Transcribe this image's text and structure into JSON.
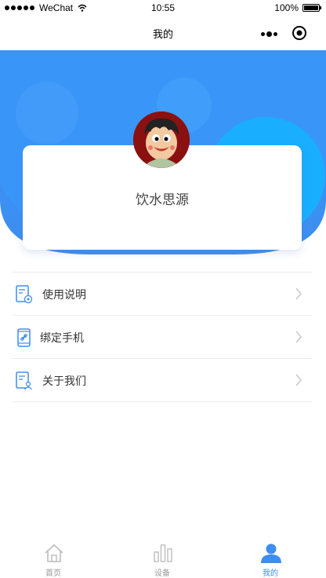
{
  "status_bar": {
    "carrier": "WeChat",
    "time": "10:55",
    "battery": "100%"
  },
  "nav": {
    "title": "我的"
  },
  "profile": {
    "username": "饮水思源"
  },
  "menu": [
    {
      "label": "使用说明",
      "icon": "manual-icon"
    },
    {
      "label": "绑定手机",
      "icon": "phone-link-icon"
    },
    {
      "label": "关于我们",
      "icon": "about-icon"
    }
  ],
  "tabs": [
    {
      "label": "首页",
      "icon": "home-icon",
      "active": false
    },
    {
      "label": "设备",
      "icon": "device-chart-icon",
      "active": false
    },
    {
      "label": "我的",
      "icon": "user-icon",
      "active": true
    }
  ],
  "colors": {
    "accent": "#3d8ef0",
    "banner": "#3a95f8",
    "banner_circle": "#1aaeff"
  }
}
